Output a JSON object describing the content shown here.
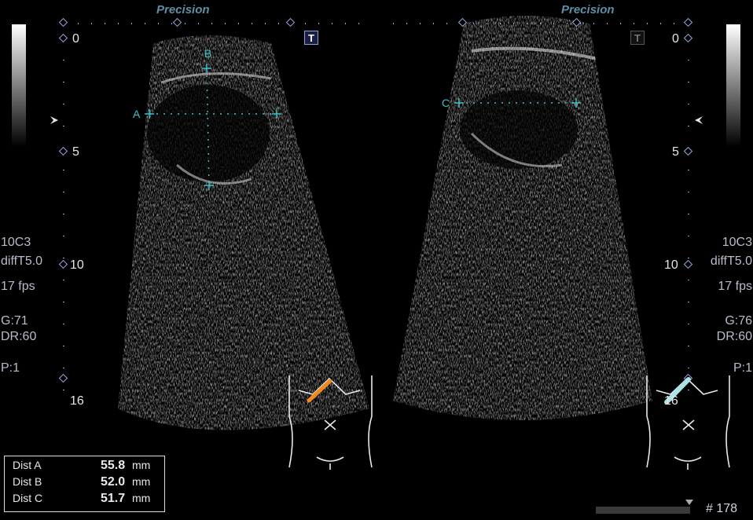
{
  "header": {
    "left_label": "Precision",
    "right_label": "Precision",
    "t_button": "T"
  },
  "scale": {
    "left_ticks": [
      "0",
      "5",
      "10",
      "16"
    ],
    "right_ticks": [
      "0",
      "5",
      "10",
      "16"
    ]
  },
  "left_panel": {
    "probe": "10C3",
    "mode": "diffT5.0",
    "fps": "17 fps",
    "gain": "G:71",
    "dr": "DR:60",
    "preset": "P:1"
  },
  "right_panel": {
    "probe": "10C3",
    "mode": "diffT5.0",
    "fps": "17 fps",
    "gain": "G:76",
    "dr": "DR:60",
    "preset": "P:1"
  },
  "caliper_labels": {
    "a": "A",
    "b": "B",
    "c": "C"
  },
  "measurements": [
    {
      "label": "Dist A",
      "value": "55.8",
      "unit": "mm"
    },
    {
      "label": "Dist B",
      "value": "52.0",
      "unit": "mm"
    },
    {
      "label": "Dist C",
      "value": "51.7",
      "unit": "mm"
    }
  ],
  "cine": {
    "frame_label": "# 178",
    "progress": 1.0
  },
  "colors": {
    "caliper": "#3fc1c9",
    "probe_left": "#f08a1c",
    "probe_right": "#a9e3e6",
    "text": "#b8bccc"
  }
}
